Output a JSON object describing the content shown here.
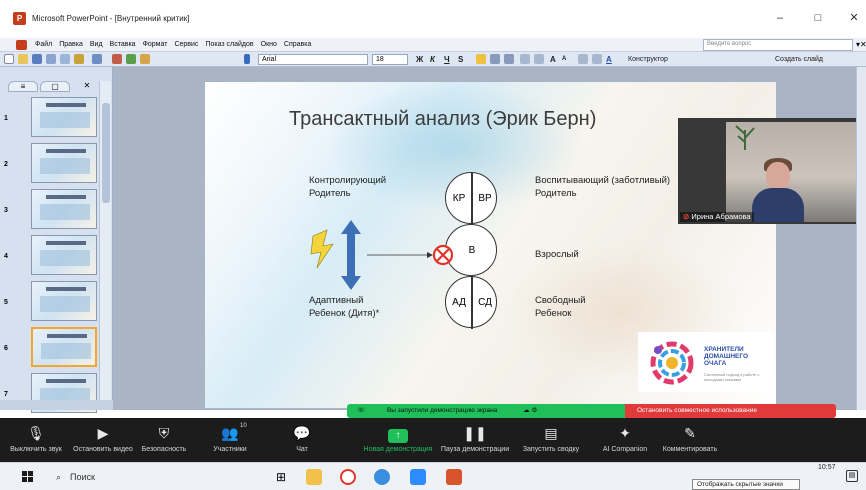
{
  "window": {
    "title": "Microsoft PowerPoint - [Внутренний критик]",
    "minimize": "–",
    "maximize": "□",
    "close": "✕"
  },
  "menu": {
    "items": [
      "Файл",
      "Правка",
      "Вид",
      "Вставка",
      "Формат",
      "Сервис",
      "Показ слайдов",
      "Окно",
      "Справка"
    ],
    "ask_placeholder": "Введите вопрос"
  },
  "toolbar": {
    "font": "Arial",
    "size": "18",
    "bold": "Ж",
    "italic": "К",
    "underline": "Ч",
    "shadow": "S",
    "designer": "Конструктор",
    "new_slide": "Создать слайд"
  },
  "side_panel": {
    "tabs": [
      "≡",
      "▢",
      "✕"
    ],
    "slide_numbers": [
      "1",
      "2",
      "3",
      "4",
      "5",
      "6",
      "7"
    ],
    "active_slide": "6"
  },
  "slide": {
    "title": "Трансактный анализ (Эрик Берн)",
    "left_top": [
      "Контролирующий",
      "Родитель"
    ],
    "left_bottom": [
      "Адаптивный",
      "Ребенок (Дитя)*"
    ],
    "right_top": [
      "Воспитывающий (заботливый)",
      "Родитель"
    ],
    "right_mid": "Взрослый",
    "right_bottom": [
      "Свободный",
      "Ребенок"
    ],
    "circle_top": [
      "КР",
      "ВР"
    ],
    "circle_mid": "В",
    "circle_bottom": [
      "АД",
      "СД"
    ],
    "logo": [
      "ХРАНИТЕЛИ",
      "ДОМАШНЕГО",
      "ОЧАГА"
    ],
    "logo_sub": "Системный подход к работе с молодыми семьями"
  },
  "video": {
    "participant": "Ирина Абрамова"
  },
  "share": {
    "banner": "Вы запустили демонстрацию экрана",
    "stop": "Остановить совместное использование"
  },
  "zoom_toolbar": {
    "items": [
      {
        "icon": "🎙",
        "label": "Выключить звук"
      },
      {
        "icon": "▶",
        "label": "Остановить видео"
      },
      {
        "icon": "⛨",
        "label": "Безопасность"
      },
      {
        "icon": "👥",
        "label": "Участники",
        "badge": "10"
      },
      {
        "icon": "💬",
        "label": "Чат"
      },
      {
        "icon": "↑",
        "label": "Новая демонстрация",
        "green": true
      },
      {
        "icon": "❚❚",
        "label": "Пауза демонстрации"
      },
      {
        "icon": "▤",
        "label": "Запустить сводку"
      },
      {
        "icon": "✦",
        "label": "AI Companion"
      },
      {
        "icon": "✎",
        "label": "Комментировать"
      }
    ]
  },
  "taskbar": {
    "search": "Поиск",
    "tooltip": "Отображать скрытые значки",
    "time": "10:57"
  },
  "colors": {
    "zoom_green": "#1fbf5a",
    "stop_red": "#e03a3a",
    "arrow_blue": "#3d6fb6",
    "bolt_yellow": "#f3d43a",
    "forbid_red": "#e0352b"
  }
}
